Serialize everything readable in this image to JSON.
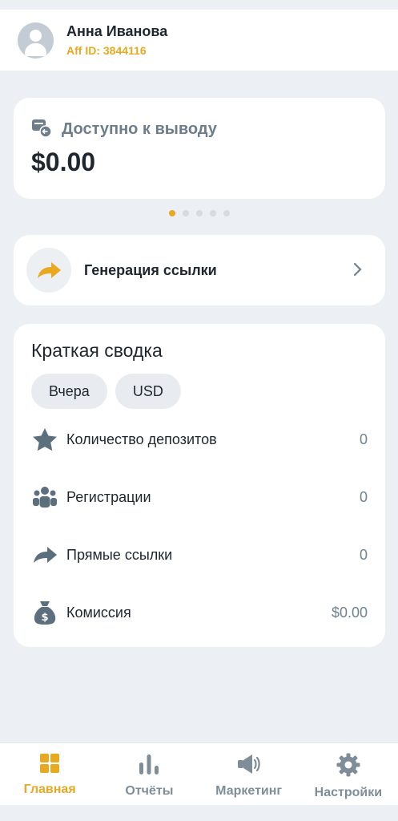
{
  "user": {
    "name": "Анна Иванова",
    "aff_id": "Aff ID: 3844116"
  },
  "balance": {
    "title": "Доступно к выводу",
    "amount": "$0.00"
  },
  "carousel": {
    "pages": 5,
    "active": 0
  },
  "generate_link": {
    "label": "Генерация ссылки"
  },
  "summary": {
    "title": "Краткая сводка",
    "chips": [
      "Вчера",
      "USD"
    ],
    "rows": [
      {
        "icon": "star-icon",
        "label": "Количество депозитов",
        "value": "0"
      },
      {
        "icon": "users-icon",
        "label": "Регистрации",
        "value": "0"
      },
      {
        "icon": "share-arrow-icon",
        "label": "Прямые ссылки",
        "value": "0"
      },
      {
        "icon": "money-bag-icon",
        "label": "Комиссия",
        "value": "$0.00"
      }
    ]
  },
  "tabs": [
    {
      "icon": "grid-icon",
      "label": "Главная",
      "active": true
    },
    {
      "icon": "bar-chart-icon",
      "label": "Отчёты",
      "active": false
    },
    {
      "icon": "megaphone-icon",
      "label": "Маркетинг",
      "active": false
    },
    {
      "icon": "gear-icon",
      "label": "Настройки",
      "active": false
    }
  ],
  "colors": {
    "accent": "#e8a921",
    "muted": "#6d8394",
    "background": "#eceff3"
  }
}
